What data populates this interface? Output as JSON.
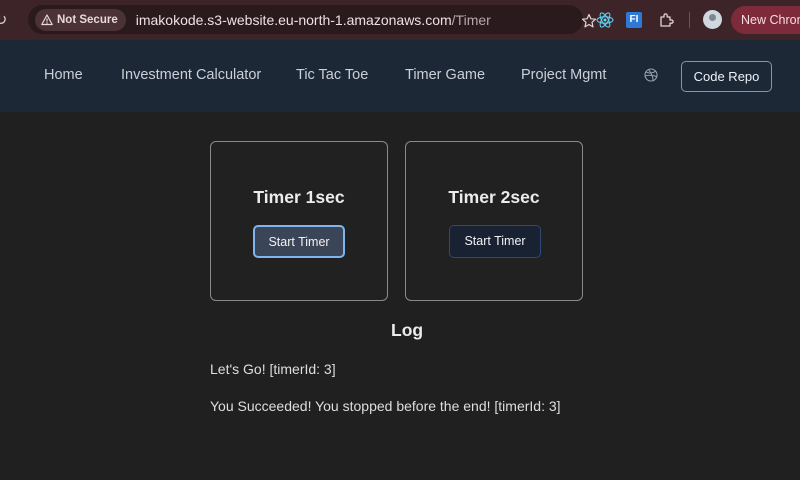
{
  "browser": {
    "security_label": "Not Secure",
    "url_host": "imakokode.s3-website.eu-north-1.amazonaws.com",
    "url_path": "/Timer",
    "new_chrome_label": "New Chrom",
    "ext_fi_label": "FI"
  },
  "nav": {
    "links": [
      "Home",
      "Investment Calculator",
      "Tic Tac Toe",
      "Timer Game",
      "Project Mgmt"
    ],
    "code_repo_label": "Code Repo"
  },
  "timers": [
    {
      "title": "Timer 1sec",
      "button_label": "Start Timer"
    },
    {
      "title": "Timer 2sec",
      "button_label": "Start Timer"
    }
  ],
  "log": {
    "title": "Log",
    "entries": [
      "Let's Go! [timerId: 3]",
      "You Succeeded! You stopped before the end! [timerId: 3]"
    ]
  },
  "colors": {
    "browser_bar": "#3c2428",
    "navbar": "#1d2836",
    "page_bg": "#202020",
    "accent_focus": "#7fb4ee"
  }
}
